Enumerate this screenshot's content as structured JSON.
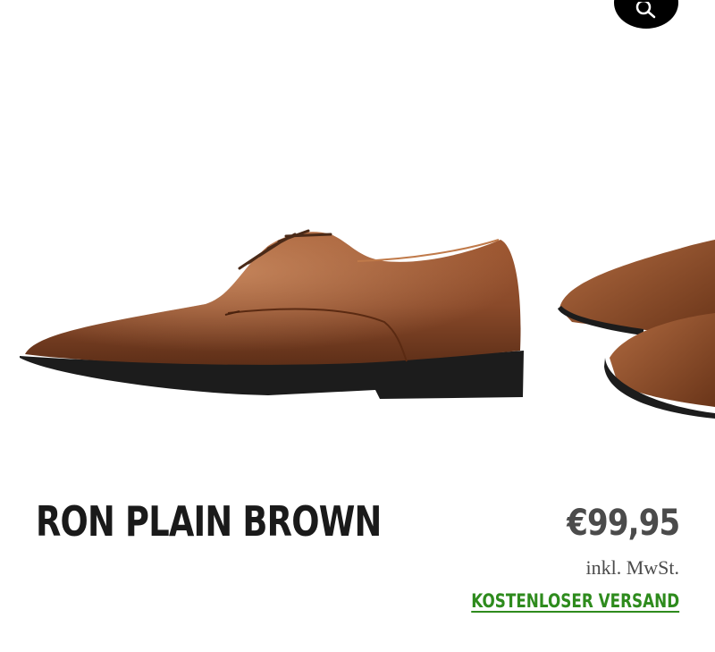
{
  "gallery": {
    "zoom_icon": "search-icon",
    "images": [
      "brown-derby-shoe-side-view",
      "brown-derby-shoes-pair-partial"
    ]
  },
  "product": {
    "title": "RON PLAIN BROWN",
    "price": "€99,95",
    "tax_note": "inkl. MwSt.",
    "shipping_label": "KOSTENLOSER VERSAND"
  },
  "colors": {
    "shoe_leather": "#8a4a2a",
    "sole": "#1c1c1c",
    "shipping_link": "#2e8b1d",
    "price_text": "#4b4b4b"
  }
}
